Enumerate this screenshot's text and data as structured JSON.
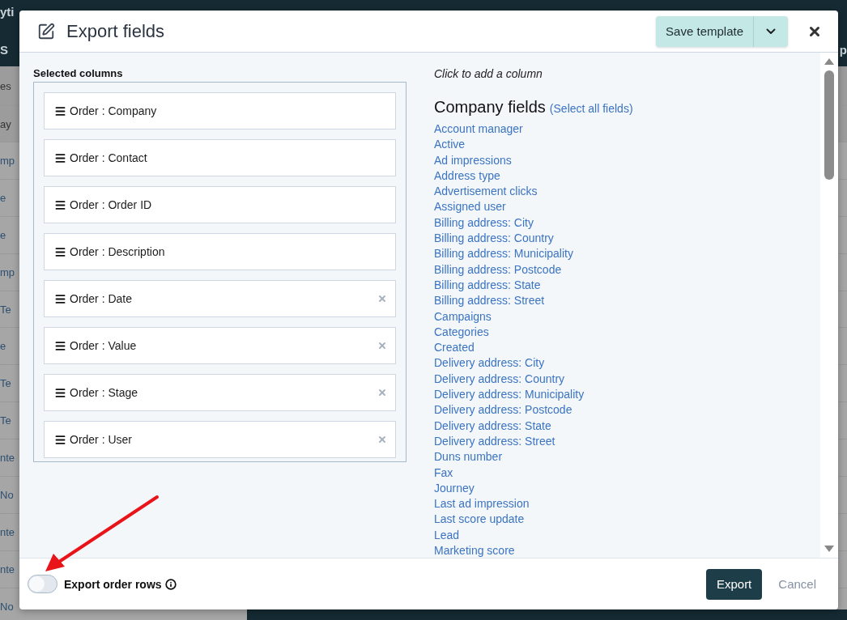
{
  "background": {
    "topbar_texts": [
      "yti",
      "S",
      "p"
    ],
    "rows": [
      "es",
      "ay",
      "mp",
      "e",
      "e",
      "mp",
      "Te",
      "e",
      "Te",
      "Te",
      "nte",
      "No",
      "nte",
      "nte",
      "No"
    ]
  },
  "dialog": {
    "title": "Export fields",
    "save_button": "Save template",
    "selected_columns": {
      "heading": "Selected columns",
      "items": [
        {
          "label": "Order : Company",
          "removable": false
        },
        {
          "label": "Order : Contact",
          "removable": false
        },
        {
          "label": "Order : Order ID",
          "removable": false
        },
        {
          "label": "Order : Description",
          "removable": false
        },
        {
          "label": "Order : Date",
          "removable": true
        },
        {
          "label": "Order : Value",
          "removable": true
        },
        {
          "label": "Order : Stage",
          "removable": true
        },
        {
          "label": "Order : User",
          "removable": true
        }
      ]
    },
    "available": {
      "hint": "Click to add a column",
      "group_title": "Company fields",
      "select_all": "(Select all fields)",
      "fields": [
        "Account manager",
        "Active",
        "Ad impressions",
        "Address type",
        "Advertisement clicks",
        "Assigned user",
        "Billing address: City",
        "Billing address: Country",
        "Billing address: Municipality",
        "Billing address: Postcode",
        "Billing address: State",
        "Billing address: Street",
        "Campaigns",
        "Categories",
        "Created",
        "Delivery address: City",
        "Delivery address: Country",
        "Delivery address: Municipality",
        "Delivery address: Postcode",
        "Delivery address: State",
        "Delivery address: Street",
        "Duns number",
        "Fax",
        "Journey",
        "Last ad impression",
        "Last score update",
        "Lead",
        "Marketing score"
      ]
    },
    "export_rows": {
      "label": "Export order rows",
      "on": false
    },
    "buttons": {
      "export": "Export",
      "cancel": "Cancel"
    }
  }
}
